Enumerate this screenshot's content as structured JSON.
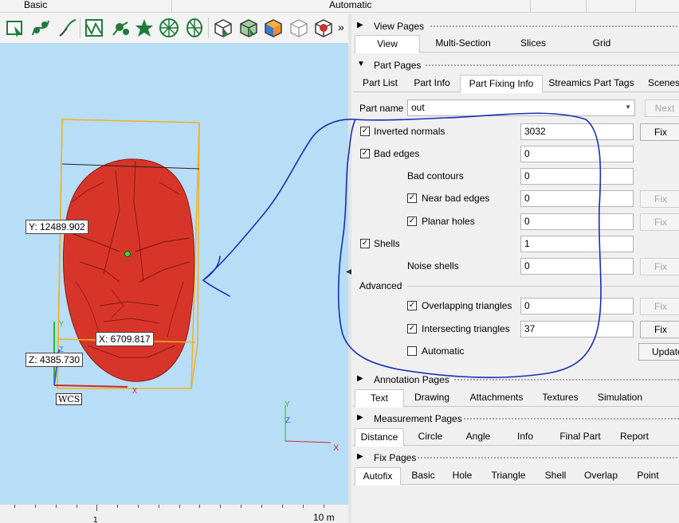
{
  "topbar": {
    "left_label": "Basic",
    "center_label": "Automatic"
  },
  "toolbar": {
    "icons": [
      "select-icon",
      "curve-node-icon",
      "curve-icon",
      "mesh-icon",
      "node-edit-icon",
      "star-mesh-icon",
      "wheel-icon",
      "spoke-icon",
      "cube-icon",
      "cube-mesh-icon",
      "cube-color-icon",
      "cube-outline-icon",
      "cube-red-icon"
    ],
    "more_label": "»",
    "colors": {
      "icon_green": "#1f7a3a",
      "icon_dark": "#3a3a3a"
    }
  },
  "viewport": {
    "bg_color": "#b8ddf6",
    "object_color": "#d8352a",
    "bbox_color": "#f0b020",
    "coords": {
      "y": "Y: 12489.902",
      "x": "X: 6709.817",
      "z": "Z: 4385.730"
    },
    "wcs_label": "WCS",
    "axes": {
      "x": "X",
      "y": "Y",
      "z": "Z"
    },
    "scale_label": "10 m",
    "scale_tick": "1"
  },
  "panel": {
    "view_pages": {
      "title": "View Pages",
      "tabs": [
        "View",
        "Multi-Section",
        "Slices",
        "Grid"
      ],
      "active": "View"
    },
    "part_pages": {
      "title": "Part Pages",
      "tabs": [
        "Part List",
        "Part Info",
        "Part Fixing Info",
        "Streamics Part Tags",
        "Scenes"
      ],
      "active": "Part Fixing Info"
    },
    "fixing_info": {
      "part_name_label": "Part name",
      "part_name_value": "out",
      "next_button": "Next",
      "rows": {
        "inverted_normals": {
          "label": "Inverted normals",
          "value": "3032",
          "fix": "Fix"
        },
        "bad_edges": {
          "label": "Bad edges",
          "value": "0"
        },
        "bad_contours": {
          "label": "Bad contours",
          "value": "0"
        },
        "near_bad_edges": {
          "label": "Near bad edges",
          "value": "0",
          "fix": "Fix"
        },
        "planar_holes": {
          "label": "Planar holes",
          "value": "0",
          "fix": "Fix"
        },
        "shells": {
          "label": "Shells",
          "value": "1"
        },
        "noise_shells": {
          "label": "Noise shells",
          "value": "0",
          "fix": "Fix"
        }
      },
      "advanced_label": "Advanced",
      "advanced": {
        "overlapping_triangles": {
          "label": "Overlapping triangles",
          "value": "0",
          "fix": "Fix"
        },
        "intersecting_triangles": {
          "label": "Intersecting triangles",
          "value": "37",
          "fix": "Fix"
        },
        "automatic": {
          "label": "Automatic",
          "button": "Update"
        }
      }
    },
    "annotation_pages": {
      "title": "Annotation Pages",
      "tabs": [
        "Text",
        "Drawing",
        "Attachments",
        "Textures",
        "Simulation"
      ],
      "active": "Text"
    },
    "measurement_pages": {
      "title": "Measurement Pages",
      "tabs": [
        "Distance",
        "Circle",
        "Angle",
        "Info",
        "Final Part",
        "Report"
      ],
      "active": "Distance"
    },
    "fix_pages": {
      "title": "Fix Pages",
      "tabs": [
        "Autofix",
        "Basic",
        "Hole",
        "Triangle",
        "Shell",
        "Overlap",
        "Point"
      ],
      "active": "Autofix"
    }
  },
  "annotation_ink_color": "#1a2fb0"
}
